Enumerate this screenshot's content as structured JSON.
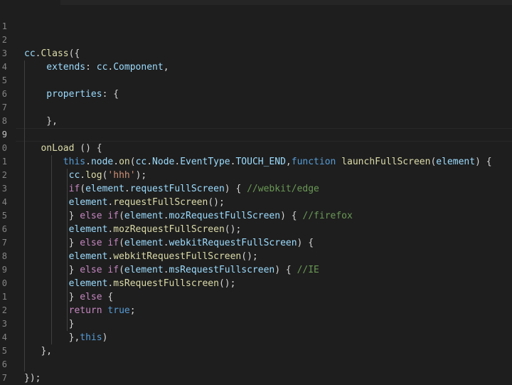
{
  "editor": {
    "line_numbers": [
      "1",
      "2",
      "3",
      "4",
      "5",
      "6",
      "7",
      "8",
      "9",
      "0",
      "1",
      "2",
      "3",
      "4",
      "5",
      "6",
      "7",
      "8",
      "9",
      "0",
      "1",
      "2",
      "3",
      "4",
      "5",
      "6",
      "7"
    ],
    "lines": [
      [],
      [],
      [
        {
          "t": "cc",
          "c": "pr"
        },
        {
          "t": ".",
          "c": "pl"
        },
        {
          "t": "Class",
          "c": "fn"
        },
        {
          "t": "({",
          "c": "pl"
        }
      ],
      [
        {
          "t": "    extends",
          "c": "pr"
        },
        {
          "t": ": ",
          "c": "pl"
        },
        {
          "t": "cc",
          "c": "pr"
        },
        {
          "t": ".",
          "c": "pl"
        },
        {
          "t": "Component",
          "c": "pr"
        },
        {
          "t": ",",
          "c": "pl"
        }
      ],
      [],
      [
        {
          "t": "    properties",
          "c": "pr"
        },
        {
          "t": ": {",
          "c": "pl"
        }
      ],
      [],
      [
        {
          "t": "    },",
          "c": "pl"
        }
      ],
      [],
      [
        {
          "t": "   ",
          "c": "pl"
        },
        {
          "t": "onLoad",
          "c": "fn"
        },
        {
          "t": " () {",
          "c": "pl"
        }
      ],
      [
        {
          "t": "       ",
          "c": "pl"
        },
        {
          "t": "this",
          "c": "kw"
        },
        {
          "t": ".",
          "c": "pl"
        },
        {
          "t": "node",
          "c": "pr"
        },
        {
          "t": ".",
          "c": "pl"
        },
        {
          "t": "on",
          "c": "fn"
        },
        {
          "t": "(",
          "c": "pl"
        },
        {
          "t": "cc",
          "c": "pr"
        },
        {
          "t": ".",
          "c": "pl"
        },
        {
          "t": "Node",
          "c": "pr"
        },
        {
          "t": ".",
          "c": "pl"
        },
        {
          "t": "EventType",
          "c": "pr"
        },
        {
          "t": ".",
          "c": "pl"
        },
        {
          "t": "TOUCH_END",
          "c": "pr"
        },
        {
          "t": ",",
          "c": "pl"
        },
        {
          "t": "function",
          "c": "kw"
        },
        {
          "t": " ",
          "c": "pl"
        },
        {
          "t": "launchFullScreen",
          "c": "fn"
        },
        {
          "t": "(",
          "c": "pl"
        },
        {
          "t": "element",
          "c": "pr"
        },
        {
          "t": ") {",
          "c": "pl"
        }
      ],
      [
        {
          "t": "        ",
          "c": "pl"
        },
        {
          "t": "cc",
          "c": "pr"
        },
        {
          "t": ".",
          "c": "pl"
        },
        {
          "t": "log",
          "c": "fn"
        },
        {
          "t": "(",
          "c": "pl"
        },
        {
          "t": "'hhh'",
          "c": "str"
        },
        {
          "t": ");",
          "c": "pl"
        }
      ],
      [
        {
          "t": "        ",
          "c": "pl"
        },
        {
          "t": "if",
          "c": "ctl"
        },
        {
          "t": "(",
          "c": "pl"
        },
        {
          "t": "element",
          "c": "pr"
        },
        {
          "t": ".",
          "c": "pl"
        },
        {
          "t": "requestFullScreen",
          "c": "pr"
        },
        {
          "t": ") { ",
          "c": "pl"
        },
        {
          "t": "//webkit/edge",
          "c": "cm"
        }
      ],
      [
        {
          "t": "        ",
          "c": "pl"
        },
        {
          "t": "element",
          "c": "pr"
        },
        {
          "t": ".",
          "c": "pl"
        },
        {
          "t": "requestFullScreen",
          "c": "fn"
        },
        {
          "t": "();",
          "c": "pl"
        }
      ],
      [
        {
          "t": "        } ",
          "c": "pl"
        },
        {
          "t": "else",
          "c": "ctl"
        },
        {
          "t": " ",
          "c": "pl"
        },
        {
          "t": "if",
          "c": "ctl"
        },
        {
          "t": "(",
          "c": "pl"
        },
        {
          "t": "element",
          "c": "pr"
        },
        {
          "t": ".",
          "c": "pl"
        },
        {
          "t": "mozRequestFullScreen",
          "c": "pr"
        },
        {
          "t": ") { ",
          "c": "pl"
        },
        {
          "t": "//firefox",
          "c": "cm"
        }
      ],
      [
        {
          "t": "        ",
          "c": "pl"
        },
        {
          "t": "element",
          "c": "pr"
        },
        {
          "t": ".",
          "c": "pl"
        },
        {
          "t": "mozRequestFullScreen",
          "c": "fn"
        },
        {
          "t": "();",
          "c": "pl"
        }
      ],
      [
        {
          "t": "        } ",
          "c": "pl"
        },
        {
          "t": "else",
          "c": "ctl"
        },
        {
          "t": " ",
          "c": "pl"
        },
        {
          "t": "if",
          "c": "ctl"
        },
        {
          "t": "(",
          "c": "pl"
        },
        {
          "t": "element",
          "c": "pr"
        },
        {
          "t": ".",
          "c": "pl"
        },
        {
          "t": "webkitRequestFullScreen",
          "c": "pr"
        },
        {
          "t": ") {",
          "c": "pl"
        }
      ],
      [
        {
          "t": "        ",
          "c": "pl"
        },
        {
          "t": "element",
          "c": "pr"
        },
        {
          "t": ".",
          "c": "pl"
        },
        {
          "t": "webkitRequestFullScreen",
          "c": "fn"
        },
        {
          "t": "();",
          "c": "pl"
        }
      ],
      [
        {
          "t": "        } ",
          "c": "pl"
        },
        {
          "t": "else",
          "c": "ctl"
        },
        {
          "t": " ",
          "c": "pl"
        },
        {
          "t": "if",
          "c": "ctl"
        },
        {
          "t": "(",
          "c": "pl"
        },
        {
          "t": "element",
          "c": "pr"
        },
        {
          "t": ".",
          "c": "pl"
        },
        {
          "t": "msRequestFullscreen",
          "c": "pr"
        },
        {
          "t": ") { ",
          "c": "pl"
        },
        {
          "t": "//IE",
          "c": "cm"
        }
      ],
      [
        {
          "t": "        ",
          "c": "pl"
        },
        {
          "t": "element",
          "c": "pr"
        },
        {
          "t": ".",
          "c": "pl"
        },
        {
          "t": "msRequestFullscreen",
          "c": "fn"
        },
        {
          "t": "();",
          "c": "pl"
        }
      ],
      [
        {
          "t": "        } ",
          "c": "pl"
        },
        {
          "t": "else",
          "c": "ctl"
        },
        {
          "t": " {",
          "c": "pl"
        }
      ],
      [
        {
          "t": "        ",
          "c": "pl"
        },
        {
          "t": "return",
          "c": "ctl"
        },
        {
          "t": " ",
          "c": "pl"
        },
        {
          "t": "true",
          "c": "kw"
        },
        {
          "t": ";",
          "c": "pl"
        }
      ],
      [
        {
          "t": "        }",
          "c": "pl"
        }
      ],
      [
        {
          "t": "        },",
          "c": "pl"
        },
        {
          "t": "this",
          "c": "kw"
        },
        {
          "t": ")",
          "c": "pl"
        }
      ],
      [
        {
          "t": "   },",
          "c": "pl"
        }
      ],
      [],
      [
        {
          "t": "});",
          "c": "pl"
        }
      ]
    ],
    "active_line": 9
  }
}
